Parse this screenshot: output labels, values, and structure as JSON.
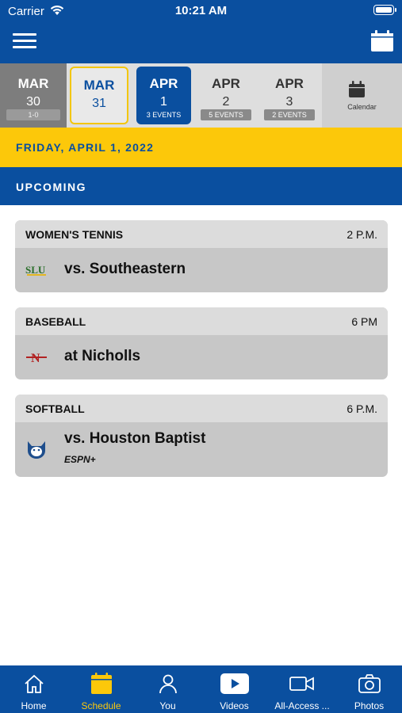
{
  "status_bar": {
    "carrier": "Carrier",
    "time": "10:21 AM",
    "battery_level": 1.0
  },
  "nav": {
    "menu_icon": "hamburger-menu-icon",
    "calendar_icon": "calendar-icon"
  },
  "colors": {
    "primary": "#0a4f9f",
    "accent": "#fcc80a",
    "card_bg": "#c7c7c7",
    "card_header_bg": "#dcdcdc"
  },
  "date_strip": {
    "days": [
      {
        "month": "MAR",
        "day": "30",
        "badge": "1-0",
        "state": "past"
      },
      {
        "month": "MAR",
        "day": "31",
        "badge": "",
        "state": "today"
      },
      {
        "month": "APR",
        "day": "1",
        "badge": "3 EVENTS",
        "state": "selected"
      },
      {
        "month": "APR",
        "day": "2",
        "badge": "5 EVENTS",
        "state": "future"
      },
      {
        "month": "APR",
        "day": "3",
        "badge": "2 EVENTS",
        "state": "future"
      }
    ],
    "calendar_label": "Calendar"
  },
  "selected_date": "FRIDAY, APRIL 1, 2022",
  "section_title": "UPCOMING",
  "events": [
    {
      "sport": "WOMEN'S TENNIS",
      "time": "2 P.M.",
      "opponent": "vs. Southeastern",
      "logo": "slu-logo-icon",
      "broadcast": ""
    },
    {
      "sport": "BASEBALL",
      "time": "6 PM",
      "opponent": "at Nicholls",
      "logo": "nicholls-logo-icon",
      "broadcast": ""
    },
    {
      "sport": "SOFTBALL",
      "time": "6 P.M.",
      "opponent": "vs. Houston Baptist",
      "logo": "houston-baptist-logo-icon",
      "broadcast": "ESPN+"
    }
  ],
  "tabs": [
    {
      "label": "Home",
      "icon": "home-icon",
      "active": false
    },
    {
      "label": "Schedule",
      "icon": "calendar-icon",
      "active": true
    },
    {
      "label": "You",
      "icon": "person-icon",
      "active": false
    },
    {
      "label": "Videos",
      "icon": "play-icon",
      "active": false
    },
    {
      "label": "All-Access ...",
      "icon": "video-camera-icon",
      "active": false
    },
    {
      "label": "Photos",
      "icon": "camera-icon",
      "active": false
    }
  ]
}
